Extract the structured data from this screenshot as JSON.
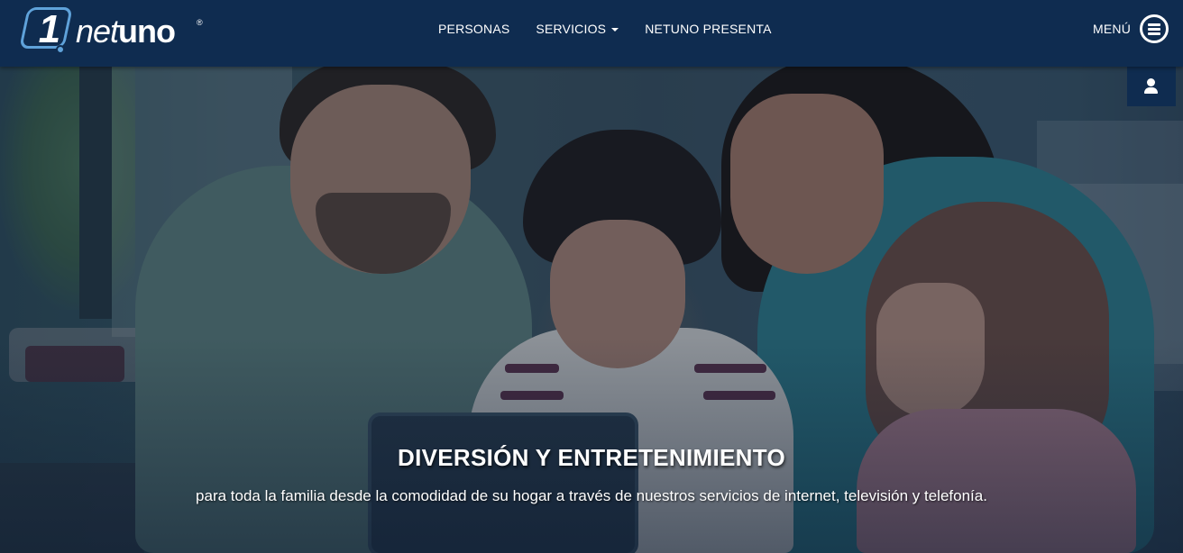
{
  "brand": {
    "logo_number": "1",
    "logo_text_light": "net",
    "logo_text_bold": "uno",
    "logo_mark": "®",
    "accent_color": "#5fa2da",
    "header_color": "#0f2c50"
  },
  "nav": {
    "items": [
      {
        "label": "PERSONAS"
      },
      {
        "label": "SERVICIOS",
        "has_dropdown": true
      },
      {
        "label": "NETUNO PRESENTA"
      }
    ]
  },
  "menu": {
    "label": "MENÚ",
    "icon": "hamburger-circle-icon"
  },
  "user_button": {
    "icon": "user-icon"
  },
  "hero": {
    "title": "DIVERSIÓN Y ENTRETENIMIENTO",
    "subtitle": "para toda la familia desde la comodidad de su hogar a través de nuestros servicios de internet, televisión y telefonía."
  }
}
